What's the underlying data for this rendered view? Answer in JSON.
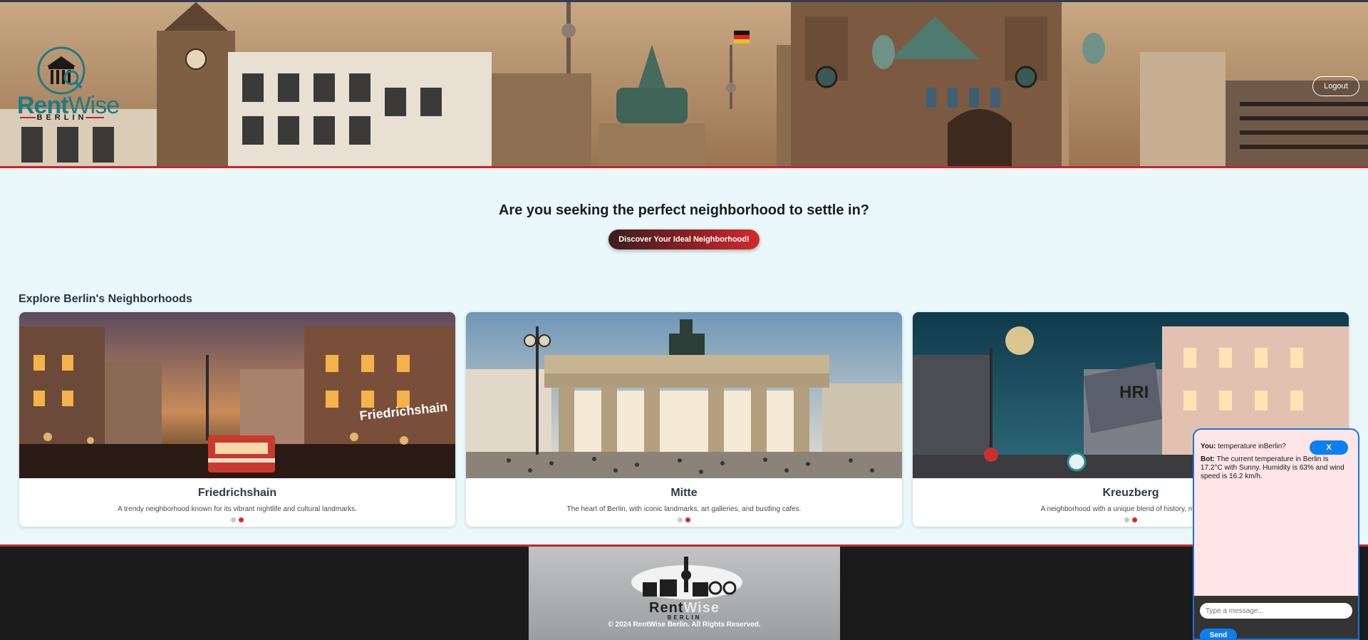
{
  "header": {
    "logo": {
      "brand_main": "Rent",
      "brand_accent": "Wise",
      "brand_sub": "BERLIN"
    },
    "logout_label": "Logout"
  },
  "hero": {
    "title": "Are you seeking the perfect neighborhood to settle in?",
    "cta_label": "Discover Your Ideal Neighborhood!"
  },
  "neighborhoods": {
    "section_title": "Explore Berlin's Neighborhoods",
    "cards": [
      {
        "name": "Friedrichshain",
        "description": "A trendy neighborhood known for its vibrant nightlife and cultural landmarks.",
        "image_sign": "Friedrichshain",
        "active_slide": 2,
        "slide_count": 2
      },
      {
        "name": "Mitte",
        "description": "The heart of Berlin, with iconic landmarks, art galleries, and bustling cafes.",
        "active_slide": 2,
        "slide_count": 2
      },
      {
        "name": "Kreuzberg",
        "description": "A neighborhood with a unique blend of history, multicultur",
        "active_slide": 2,
        "slide_count": 2
      }
    ]
  },
  "footer": {
    "brand_main": "Rent",
    "brand_accent": "Wise",
    "brand_sub": "BERLIN",
    "copyright": "© 2024 RentWise Berlin. All Rights Reserved."
  },
  "chat": {
    "close_label": "X",
    "messages": [
      {
        "speaker": "You:",
        "text": "temperature inBerlin?"
      },
      {
        "speaker": "Bot:",
        "text": "The current temperature in Berlin is 17.2°C with Sunny. Humidity is 63% and wind speed is 16.2 km/h."
      }
    ],
    "input_placeholder": "Type a message...",
    "send_label": "Send"
  },
  "colors": {
    "accent_red": "#c8242a",
    "chat_blue": "#0d7ff0",
    "page_bg": "#eaf8fb",
    "brand_teal": "#1d7b86"
  }
}
